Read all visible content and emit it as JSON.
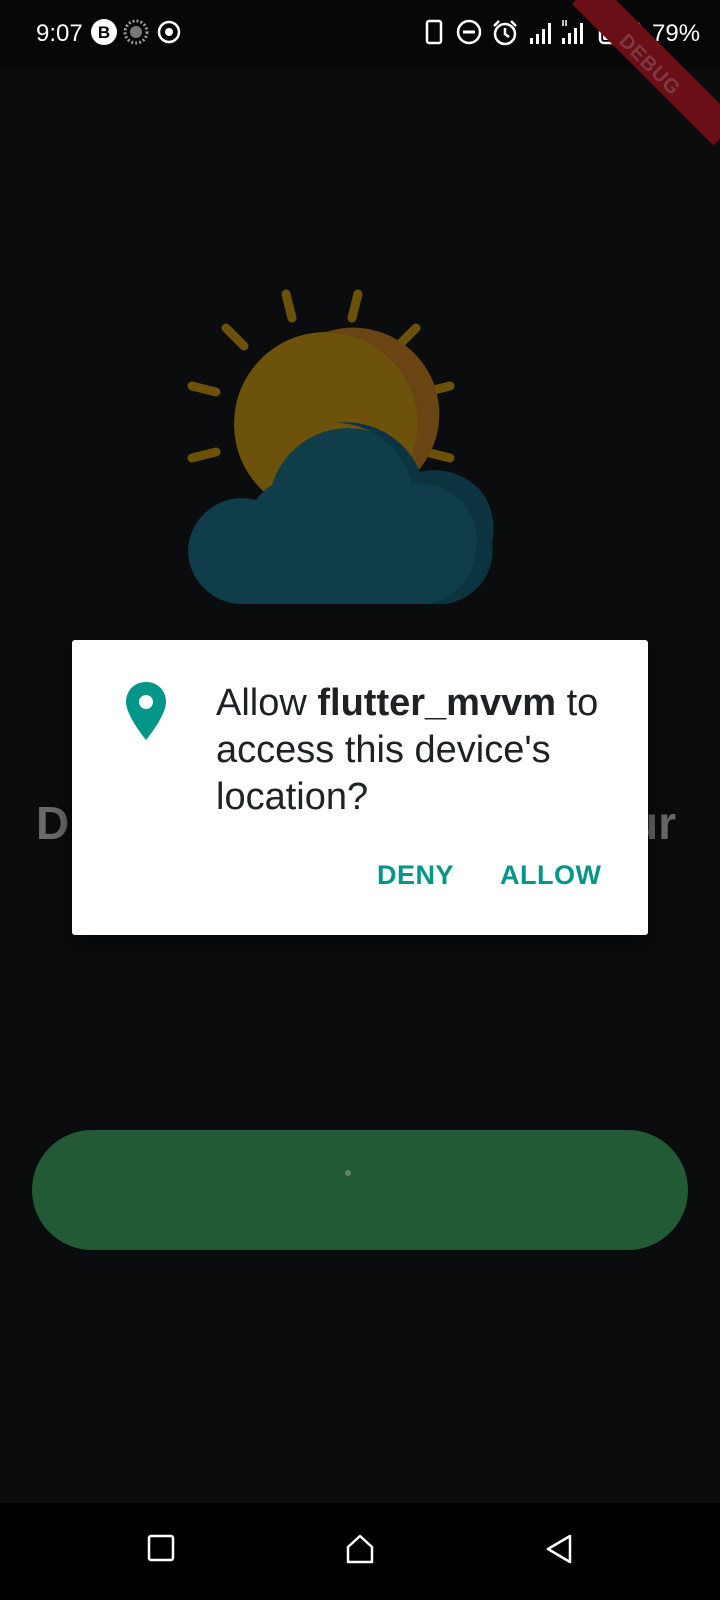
{
  "status_bar": {
    "time": "9:07",
    "battery_percent": "79%",
    "debug_banner": "DEBUG",
    "icons": [
      "b-app-icon",
      "loading-dots-icon",
      "target-icon",
      "phone-icon",
      "dnd-icon",
      "alarm-icon",
      "signal-icon",
      "signal-4g-icon",
      "battery-charging-icon"
    ]
  },
  "background": {
    "title_visible_left": "D",
    "title_visible_right": "ur",
    "illustration": "sun-cloud-weather-icon",
    "button_state": "loading"
  },
  "permission_dialog": {
    "icon": "location-pin-icon",
    "message_prefix": "Allow ",
    "app_name": "flutter_mvvm",
    "message_suffix": " to access this device's location?",
    "deny_label": "DENY",
    "allow_label": "ALLOW",
    "accent_color": "#009688"
  },
  "nav_bar": {
    "buttons": [
      "recents-square-icon",
      "home-icon",
      "back-triangle-icon"
    ]
  }
}
